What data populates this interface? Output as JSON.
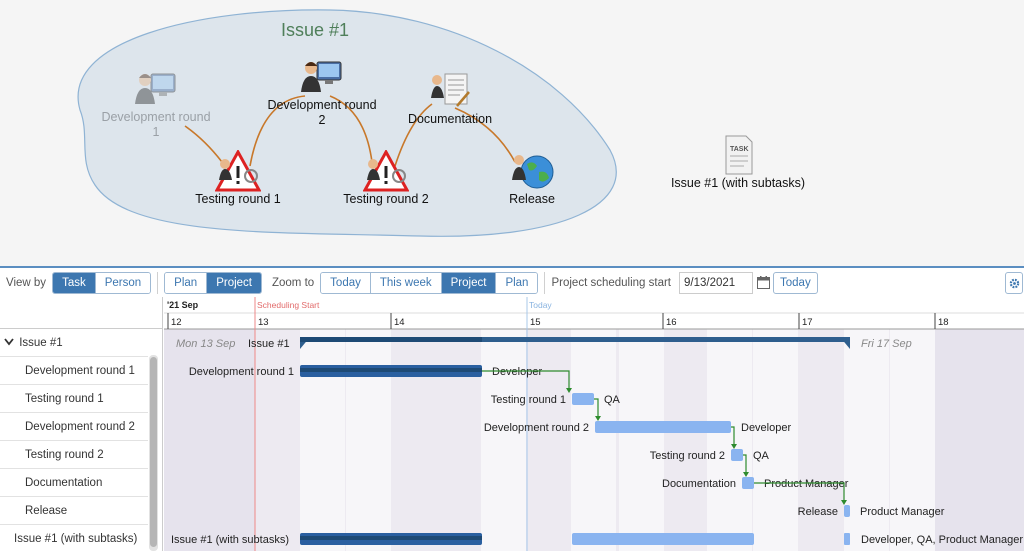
{
  "diagram": {
    "title": "Issue #1",
    "nodes": [
      {
        "id": "dev1",
        "label_line1": "Development round",
        "label_line2": "1",
        "icon": "developer-icon",
        "dimmed": true
      },
      {
        "id": "test1",
        "label_line1": "Testing round 1",
        "label_line2": "",
        "icon": "tester-warning-icon",
        "dimmed": false
      },
      {
        "id": "dev2",
        "label_line1": "Development round",
        "label_line2": "2",
        "icon": "developer-icon",
        "dimmed": false
      },
      {
        "id": "test2",
        "label_line1": "Testing round 2",
        "label_line2": "",
        "icon": "tester-warning-icon",
        "dimmed": false
      },
      {
        "id": "docs",
        "label_line1": "Documentation",
        "label_line2": "",
        "icon": "document-writer-icon",
        "dimmed": false
      },
      {
        "id": "release",
        "label_line1": "Release",
        "label_line2": "",
        "icon": "globe-person-icon",
        "dimmed": false
      },
      {
        "id": "task",
        "label_line1": "Issue #1 (with subtasks)",
        "label_line2": "",
        "icon": "task-document-icon",
        "dimmed": false
      }
    ]
  },
  "toolbar": {
    "view_by_label": "View by",
    "view_by_options": [
      "Task",
      "Person"
    ],
    "view_by_selected": "Task",
    "plan_project": [
      "Plan",
      "Project"
    ],
    "plan_project_selected": "Project",
    "zoom_label": "Zoom to",
    "zoom_options": [
      "Today",
      "This week",
      "Project",
      "Plan"
    ],
    "zoom_selected": "Project",
    "scheduling_label": "Project scheduling start",
    "scheduling_date": "9/13/2021",
    "today_button": "Today"
  },
  "gantt": {
    "header": {
      "year_month": "'21  Sep",
      "days": [
        "12",
        "13",
        "14",
        "15",
        "16",
        "17",
        "18"
      ],
      "scheduling_start_label": "Scheduling Start",
      "today_label": "Today"
    },
    "rows": [
      {
        "name": "Issue #1",
        "collapsible": true,
        "bar_label": "Issue #1",
        "assignee": ""
      },
      {
        "name": "Development round 1",
        "bar_label": "Development round 1",
        "assignee": "Developer"
      },
      {
        "name": "Testing round 1",
        "bar_label": "Testing round 1",
        "assignee": "QA"
      },
      {
        "name": "Development round 2",
        "bar_label": "Development round 2",
        "assignee": "Developer"
      },
      {
        "name": "Testing round 2",
        "bar_label": "Testing round 2",
        "assignee": "QA"
      },
      {
        "name": "Documentation",
        "bar_label": "Documentation",
        "assignee": "Product Manager"
      },
      {
        "name": "Release",
        "bar_label": "Release",
        "assignee": "Product Manager"
      },
      {
        "name": "Issue #1 (with subtasks)",
        "bar_label": "Issue #1 (with subtasks)",
        "assignee": "Developer, QA, Product Manager"
      }
    ],
    "summary_start_label": "Mon 13 Sep",
    "summary_end_label": "Fri 17 Sep",
    "colors": {
      "summary_bar": "#2e5e8e",
      "dark_bar": "#2a5fa0",
      "light_bar": "#8ab4f0",
      "dependency": "#2e8b2e",
      "weekend_shade": "#e6e3ed"
    }
  }
}
